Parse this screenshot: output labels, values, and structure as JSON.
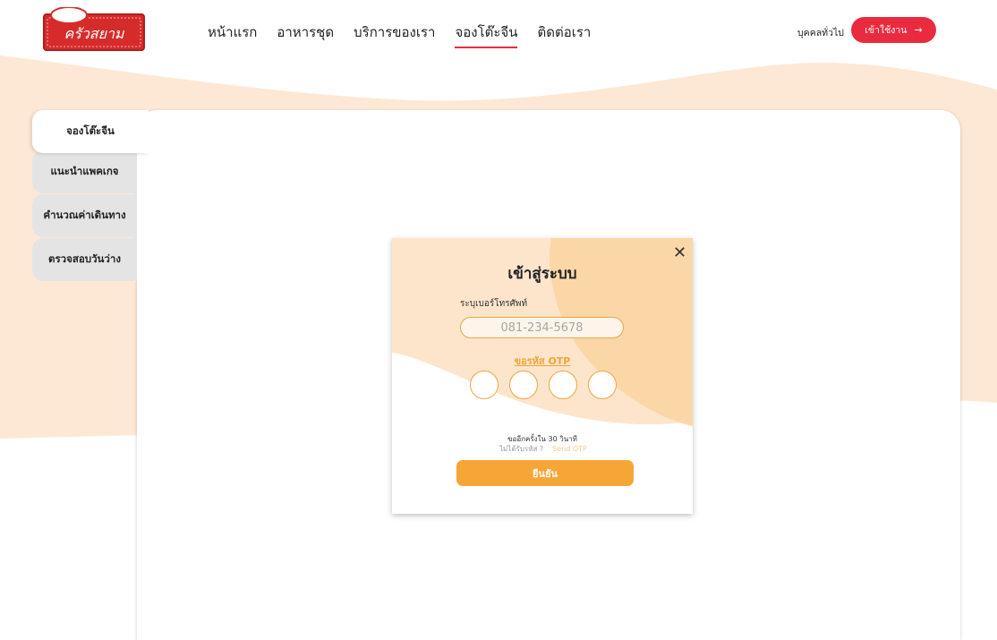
{
  "brand": {
    "logo_text": "ครัวสยาม",
    "logo_color": "#d62b2b"
  },
  "nav": {
    "items": [
      {
        "label": "หน้าแรก"
      },
      {
        "label": "อาหารชุด"
      },
      {
        "label": "บริการของเรา"
      },
      {
        "label": "จองโต๊ะจีน"
      },
      {
        "label": "ติดต่อเรา"
      }
    ],
    "active_index": 3
  },
  "header": {
    "user_type": "บุคคลทั่วไป",
    "login_label": "เข้าใช้งาน",
    "login_arrow": "→"
  },
  "sidebar": {
    "tabs": [
      {
        "label": "จองโต๊ะจีน",
        "active": true
      },
      {
        "label": "แนะนำแพคเกจ",
        "active": false
      },
      {
        "label": "คำนวณค่าเดินทาง",
        "active": false
      },
      {
        "label": "ตรวจสอบวันว่าง",
        "active": false
      }
    ]
  },
  "login_modal": {
    "close_label": "✕",
    "title": "เข้าสู่ระบบ",
    "phone_label": "ระบุเบอร์โทรศัพท์",
    "phone_placeholder": "081-234-5678",
    "request_otp_label": "ขอรหัส OTP",
    "retry_text": "ขออีกครั้งใน 30 วินาที",
    "not_received_text": "ไม่ได้รับรหัส ?",
    "send_otp_label": "Send OTP",
    "confirm_label": "ยืนยัน"
  },
  "colors": {
    "accent_red": "#ea2b3f",
    "accent_orange": "#f6a637",
    "peach_bg": "#fde8d6"
  }
}
